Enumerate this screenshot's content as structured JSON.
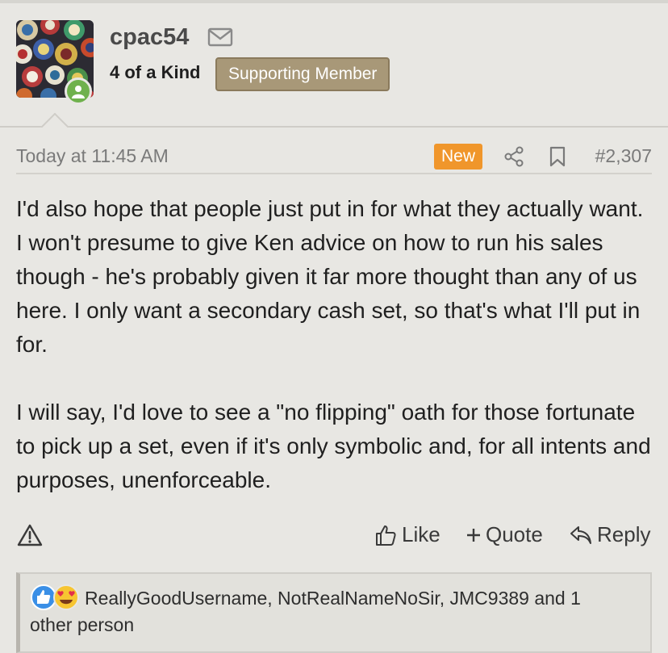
{
  "user": {
    "username": "cpac54",
    "rank": "4 of a Kind",
    "badge": "Supporting Member"
  },
  "post": {
    "timestamp": "Today at 11:45 AM",
    "new_label": "New",
    "number": "#2,307",
    "paragraphs": [
      "I'd also hope that people just put in for what they actually want. I won't presume to give Ken advice on how to run his sales though - he's probably given it far more thought than any of us here. I only want a secondary cash set, so that's what I'll put in for.",
      "I will say, I'd love to see a \"no flipping\" oath for those fortunate to pick up a set, even if it's only symbolic and, for all intents and purposes, unenforceable."
    ]
  },
  "actions": {
    "like_label": "Like",
    "quote_label": "Quote",
    "reply_label": "Reply"
  },
  "reactions": {
    "text": "ReallyGoodUsername, NotRealNameNoSir, JMC9389 and 1 other person",
    "icons": [
      "thumbs-up-icon",
      "heart-eyes-icon"
    ]
  },
  "colors": {
    "badge_bg": "#a89878",
    "new_bg": "#f0962b",
    "online": "#6fb14d",
    "background": "#e8e7e3"
  }
}
